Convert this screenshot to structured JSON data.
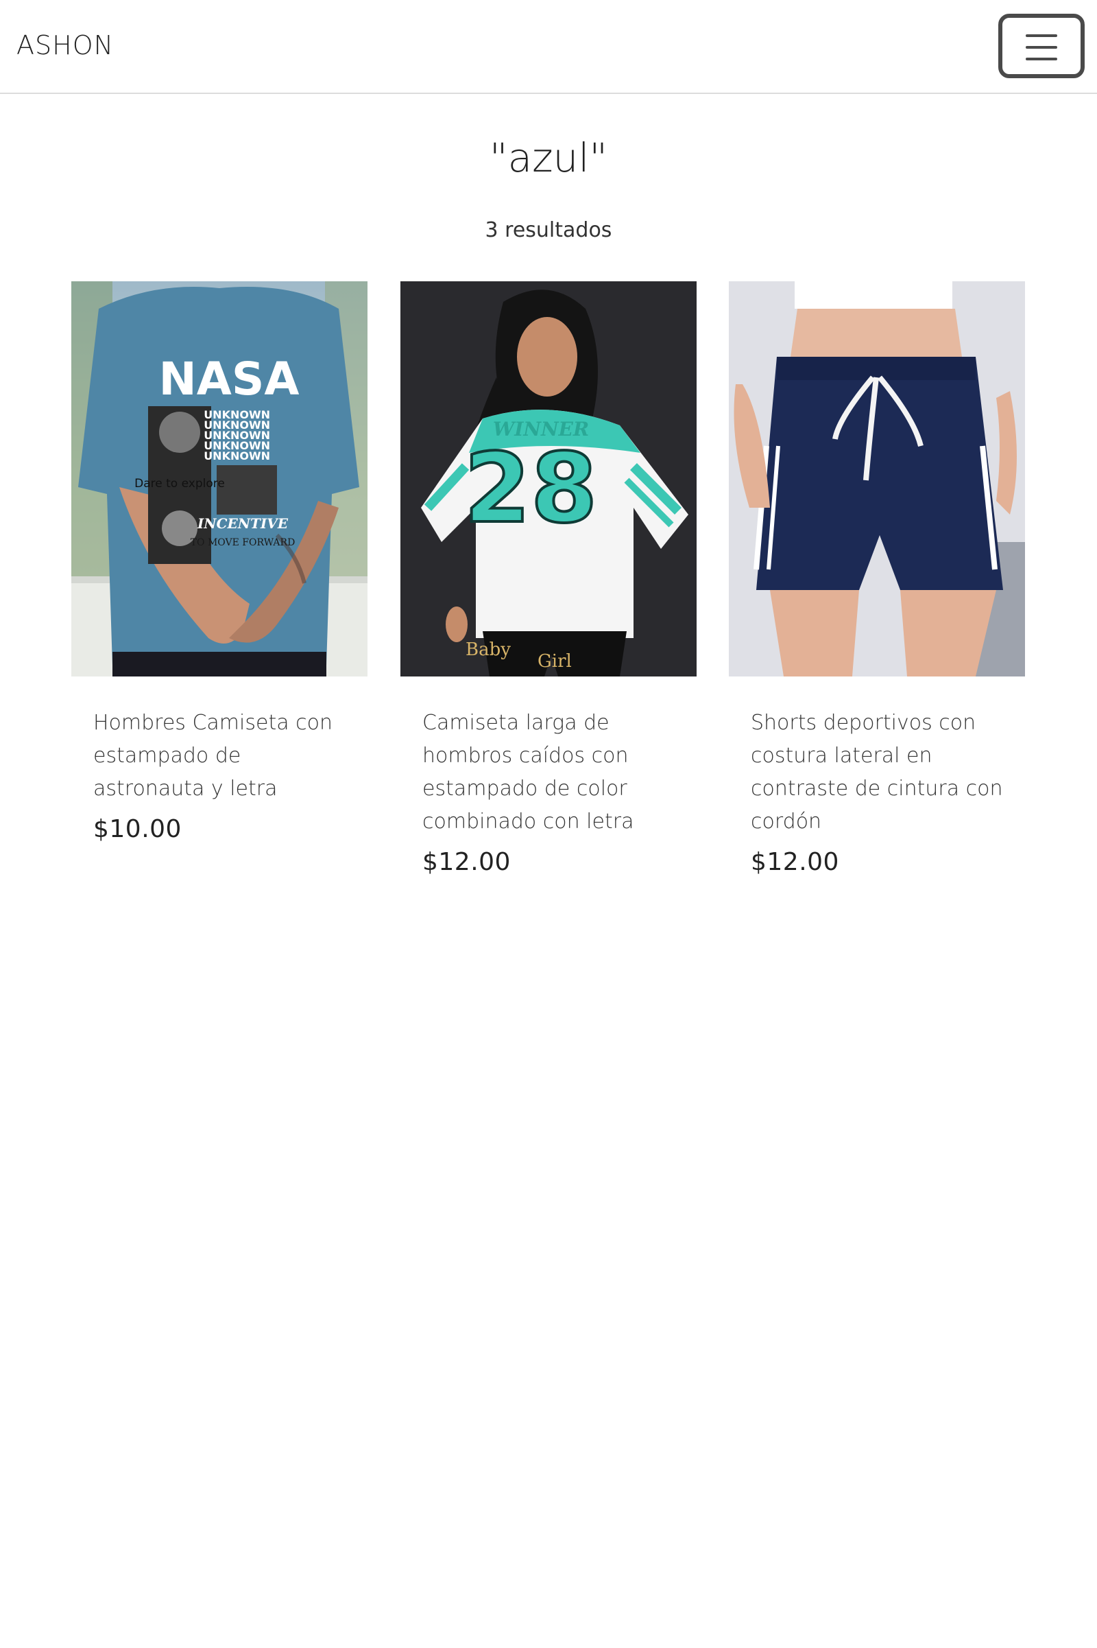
{
  "header": {
    "brand": "ASHON",
    "menu_icon": "hamburger-menu-icon"
  },
  "search": {
    "query": "\"azul\"",
    "results_count": "3 resultados"
  },
  "products": [
    {
      "title": "Hombres Camiseta con estampado de astronauta y letra",
      "price": "$10.00",
      "image_text": {
        "logo": "NASA",
        "lines": [
          "UNKNOWN",
          "UNKNOWN",
          "UNKNOWN",
          "UNKNOWN",
          "UNKNOWN"
        ],
        "dare": "Dare to explore",
        "incentive": "INCENTIVE",
        "move": "TO MOVE FORWARD"
      }
    },
    {
      "title": "Camiseta larga de hombros caídos con estampado de color combinado con letra",
      "price": "$12.00",
      "image_text": {
        "winner": "WINNER",
        "number": "28",
        "baby": "Baby",
        "girl": "Girl"
      }
    },
    {
      "title": "Shorts deportivos con costura lateral en contraste de cintura con cordón",
      "price": "$12.00"
    }
  ],
  "colors": {
    "shirt_blue": "#4f86a6",
    "jersey_teal": "#3cc7b4",
    "shorts_navy": "#1c2a55"
  }
}
